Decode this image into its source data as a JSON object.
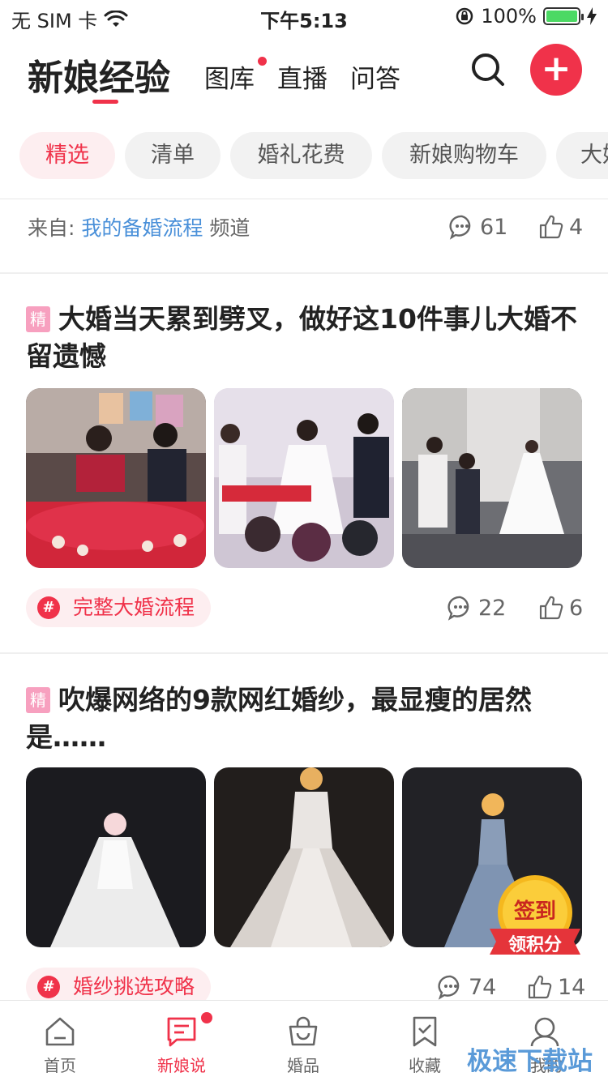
{
  "status_bar": {
    "carrier": "无 SIM 卡",
    "time": "下午5:13",
    "battery": "100%"
  },
  "header": {
    "title": "新娘经验",
    "tabs": [
      {
        "label": "图库"
      },
      {
        "label": "直播"
      },
      {
        "label": "问答"
      }
    ],
    "plus": "+"
  },
  "chips": [
    "精选",
    "清单",
    "婚礼花费",
    "新娘购物车",
    "大婚"
  ],
  "source_row": {
    "prefix": "来自:",
    "link": "我的备婚流程",
    "suffix": "频道",
    "comments": "61",
    "likes": "4"
  },
  "articles": [
    {
      "badge": "精",
      "title": "大婚当天累到劈叉，做好这10件事儿大婚不留遗憾",
      "tag": "完整大婚流程",
      "comments": "22",
      "likes": "6"
    },
    {
      "badge": "精",
      "title": "吹爆网络的9款网红婚纱，最显瘦的居然是……",
      "tag": "婚纱挑选攻略",
      "comments": "74",
      "likes": "14"
    }
  ],
  "sign_badge": {
    "line1": "签到",
    "line2": "领积分"
  },
  "tabbar": [
    {
      "label": "首页",
      "icon": "home-icon"
    },
    {
      "label": "新娘说",
      "icon": "chat-icon"
    },
    {
      "label": "婚品",
      "icon": "bag-icon"
    },
    {
      "label": "收藏",
      "icon": "bookmark-icon"
    },
    {
      "label": "我的",
      "icon": "profile-icon"
    }
  ],
  "watermark": "极速下载站",
  "colors": {
    "accent": "#f0324a",
    "link": "#4a90d9",
    "chip_bg": "#f2f2f2"
  }
}
